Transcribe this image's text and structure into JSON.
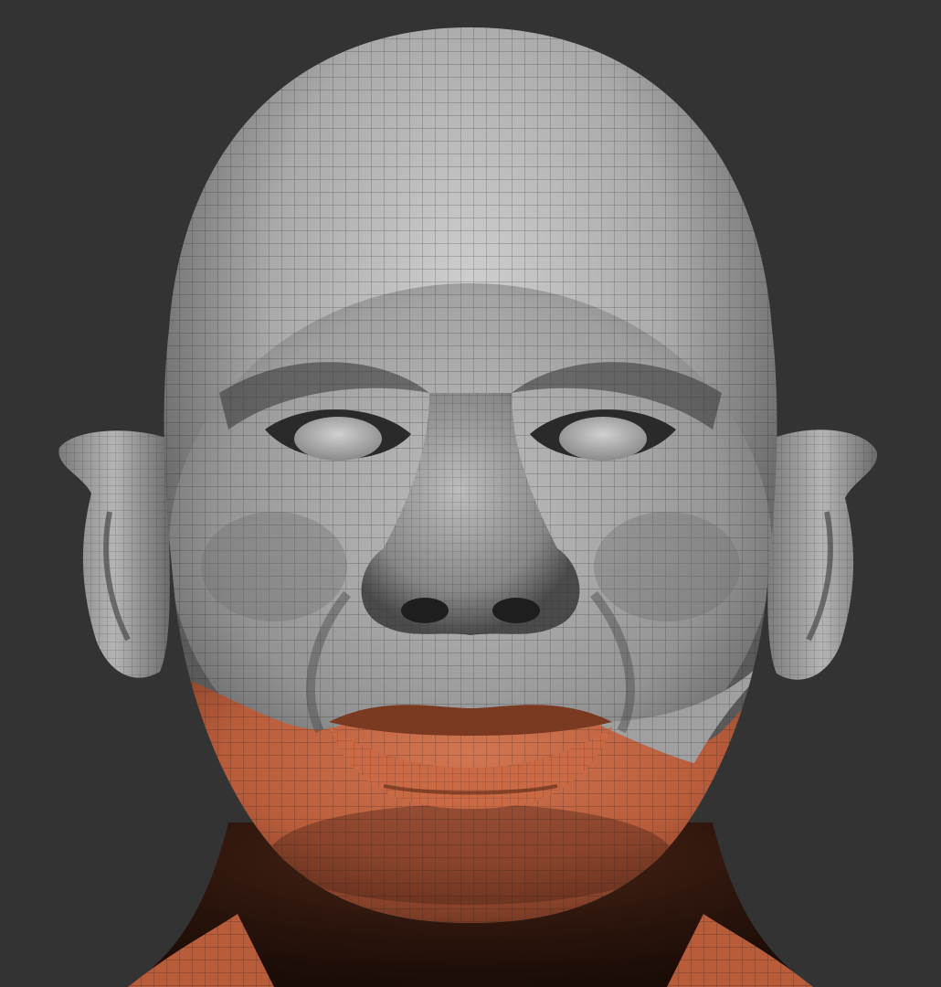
{
  "viewport": {
    "background_color": "#333333",
    "model": {
      "type": "sculpted-head-mesh",
      "wireframe": true,
      "base_color": "#a9a9a9",
      "mask_color": "#c0623f",
      "wire_color": "#1c1c1c"
    }
  }
}
